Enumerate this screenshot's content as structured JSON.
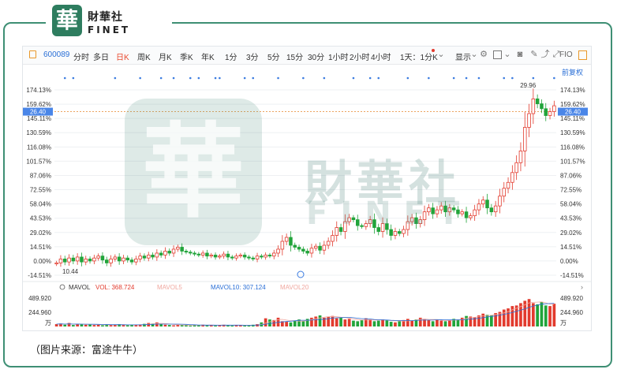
{
  "brand": {
    "logo_glyph": "華",
    "name_cn": "財華社",
    "name_en": "FINET",
    "accent_color": "#3e8f74"
  },
  "toolbar": {
    "code": "600089",
    "items": [
      "分时",
      "多日",
      "日K",
      "周K",
      "月K",
      "季K",
      "年K",
      "1分",
      "3分",
      "5分",
      "15分",
      "30分",
      "1小时",
      "2小时",
      "4小时",
      "1天：1分K"
    ],
    "active_item": "日K",
    "display_menu": "显示",
    "right_label": "FIO",
    "icons": [
      "chevron-down-icon",
      "gear-icon",
      "checkbox-icon",
      "chevron-down-icon",
      "camera-icon",
      "pencil-icon",
      "share-icon",
      "expand-icon"
    ]
  },
  "price_panel": {
    "adjust_label": "前复权",
    "y_axis_ticks": [
      "174.13%",
      "159.62%",
      "145.11%",
      "130.59%",
      "116.08%",
      "101.57%",
      "87.06%",
      "72.55%",
      "58.04%",
      "43.53%",
      "29.02%",
      "14.51%",
      "0.00%",
      "-14.51%"
    ],
    "current_value": "26.40",
    "high_label": "29.96",
    "low_label": "10.44"
  },
  "volume_panel": {
    "tabs": [
      "MAVOL",
      "VOL: 368.724",
      "MAVOL5",
      "MAVOL10: 307.124",
      "MAVOL20"
    ],
    "y_axis_ticks": [
      "489.920",
      "244.960",
      "万"
    ]
  },
  "chart_data": {
    "type": "candlestick",
    "x_count": 120,
    "y_axis_unit": "%",
    "ylim": [
      -14.51,
      174.13
    ],
    "current_value": 26.4,
    "high": 29.96,
    "low": 10.44,
    "closes_pct": [
      -2,
      2,
      -1,
      3,
      0,
      4,
      -1,
      2,
      0,
      3,
      5,
      1,
      -2,
      2,
      4,
      0,
      3,
      1,
      -1,
      2,
      5,
      3,
      6,
      4,
      8,
      6,
      10,
      8,
      12,
      14,
      10,
      9,
      8,
      7,
      6,
      8,
      5,
      6,
      4,
      5,
      7,
      4,
      3,
      5,
      6,
      4,
      3,
      2,
      5,
      4,
      6,
      5,
      8,
      12,
      20,
      24,
      16,
      14,
      12,
      10,
      8,
      13,
      15,
      11,
      16,
      20,
      26,
      34,
      30,
      40,
      44,
      42,
      36,
      35,
      38,
      42,
      34,
      30,
      38,
      32,
      26,
      30,
      28,
      32,
      40,
      44,
      38,
      42,
      50,
      54,
      48,
      52,
      56,
      50,
      54,
      52,
      48,
      50,
      44,
      46,
      52,
      58,
      62,
      54,
      50,
      56,
      66,
      74,
      80,
      90,
      100,
      112,
      136,
      150,
      165,
      160,
      155,
      148,
      152,
      158
    ],
    "vol_pct": [
      8,
      10,
      6,
      12,
      5,
      9,
      7,
      6,
      8,
      5,
      6,
      4,
      7,
      5,
      6,
      8,
      5,
      4,
      6,
      5,
      7,
      9,
      12,
      10,
      14,
      8,
      6,
      5,
      4,
      6,
      5,
      4,
      3,
      5,
      4,
      6,
      5,
      4,
      3,
      5,
      6,
      4,
      3,
      5,
      4,
      3,
      4,
      6,
      8,
      14,
      28,
      24,
      22,
      30,
      18,
      16,
      14,
      20,
      24,
      18,
      26,
      30,
      34,
      38,
      30,
      34,
      36,
      28,
      30,
      24,
      26,
      20,
      18,
      22,
      28,
      24,
      18,
      20,
      24,
      22,
      16,
      14,
      18,
      22,
      26,
      20,
      24,
      30,
      26,
      22,
      18,
      24,
      20,
      18,
      22,
      26,
      24,
      30,
      36,
      34,
      32,
      38,
      44,
      40,
      38,
      46,
      50,
      58,
      62,
      70,
      72,
      80,
      88,
      94,
      80,
      76,
      84,
      72,
      70,
      78
    ]
  },
  "caption": "（图片来源：富途牛牛）"
}
